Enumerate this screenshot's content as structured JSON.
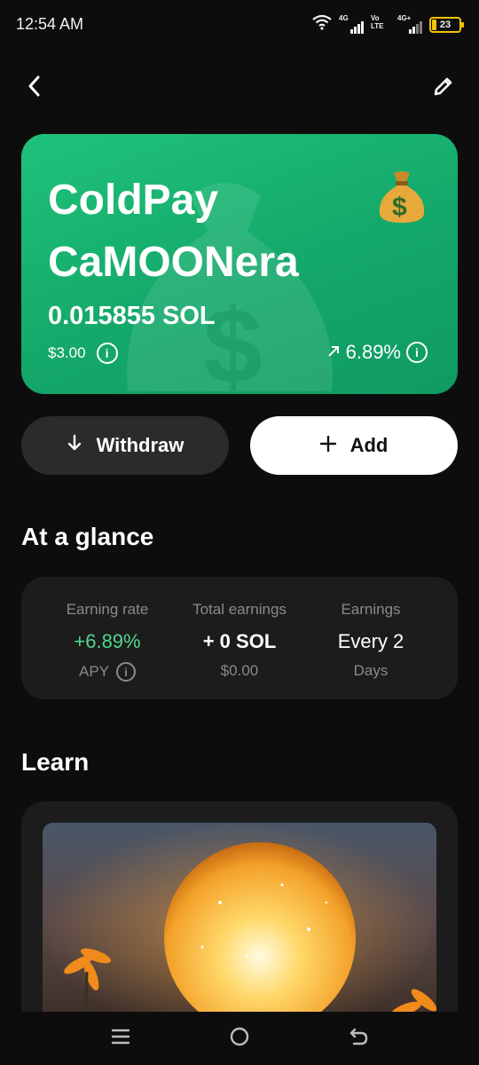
{
  "status_bar": {
    "time": "12:54 AM",
    "sim1_label": "4G",
    "sim2_label": "Vo LTE",
    "sim3_label": "4G+",
    "battery": "23",
    "battery_color": "#f2c200"
  },
  "nav": {
    "back_icon": "chevron-left-icon",
    "edit_icon": "pencil-icon"
  },
  "card": {
    "title_line1": "ColdPay",
    "title_line2": "CaMOONera",
    "amount": "0.015855 SOL",
    "usd": "$3.00",
    "change": "6.89%",
    "change_icon": "arrow-up-right-icon",
    "emoji_icon": "money-bag-icon",
    "accent": "#14a86a"
  },
  "actions": {
    "withdraw_label": "Withdraw",
    "add_label": "Add"
  },
  "glance": {
    "title": "At a glance",
    "earning_rate": {
      "label": "Earning rate",
      "value": "+6.89%",
      "sub": "APY"
    },
    "total_earnings": {
      "label": "Total earnings",
      "value": "+ 0 SOL",
      "sub": "$0.00"
    },
    "earnings": {
      "label": "Earnings",
      "value": "Every 2",
      "sub": "Days"
    },
    "positive_color": "#4fd88e"
  },
  "learn": {
    "title": "Learn",
    "image_icon": "glowing-moon-image"
  },
  "system_nav": {
    "menu_icon": "menu-icon",
    "home_icon": "home-circle-icon",
    "back_icon": "back-arrow-icon"
  }
}
